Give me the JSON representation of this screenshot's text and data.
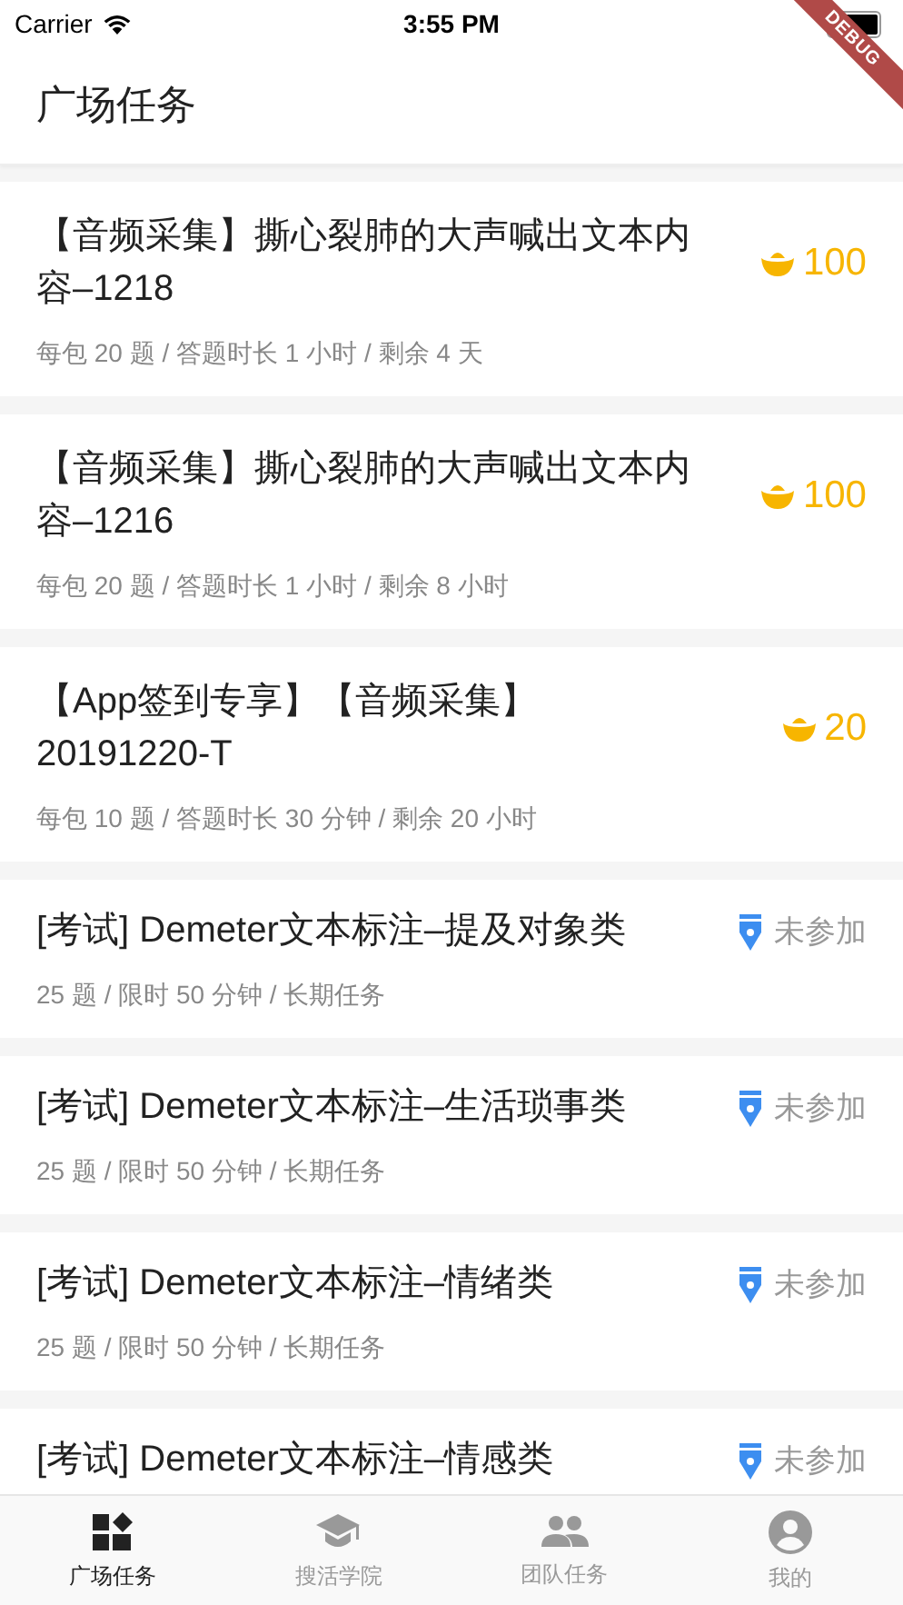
{
  "status_bar": {
    "carrier": "Carrier",
    "time": "3:55 PM"
  },
  "debug_banner": "DEBUG",
  "app_bar": {
    "title": "广场任务"
  },
  "tasks": [
    {
      "kind": "reward",
      "title": "【音频采集】撕心裂肺的大声喊出文本内容–1218",
      "meta": "每包 20 题 / 答题时长 1 小时 / 剩余 4 天",
      "amount": "100"
    },
    {
      "kind": "reward",
      "title": "【音频采集】撕心裂肺的大声喊出文本内容–1216",
      "meta": "每包 20 题 / 答题时长 1 小时 / 剩余 8 小时",
      "amount": "100"
    },
    {
      "kind": "reward",
      "title": "【App签到专享】【音频采集】20191220-T",
      "meta": "每包 10 题 / 答题时长 30 分钟 / 剩余 20 小时",
      "amount": "20"
    },
    {
      "kind": "exam",
      "title": "[考试] Demeter文本标注–提及对象类",
      "meta": "25 题 / 限时 50 分钟 / 长期任务",
      "status": "未参加"
    },
    {
      "kind": "exam",
      "title": "[考试] Demeter文本标注–生活琐事类",
      "meta": "25 题 / 限时 50 分钟 / 长期任务",
      "status": "未参加"
    },
    {
      "kind": "exam",
      "title": "[考试] Demeter文本标注–情绪类",
      "meta": "25 题 / 限时 50 分钟 / 长期任务",
      "status": "未参加"
    },
    {
      "kind": "exam",
      "title": "[考试] Demeter文本标注–情感类",
      "status": "未参加"
    }
  ],
  "tab_bar": [
    {
      "label": "广场任务",
      "selected": true
    },
    {
      "label": "搜活学院",
      "selected": false
    },
    {
      "label": "团队任务",
      "selected": false
    },
    {
      "label": "我的",
      "selected": false
    }
  ]
}
